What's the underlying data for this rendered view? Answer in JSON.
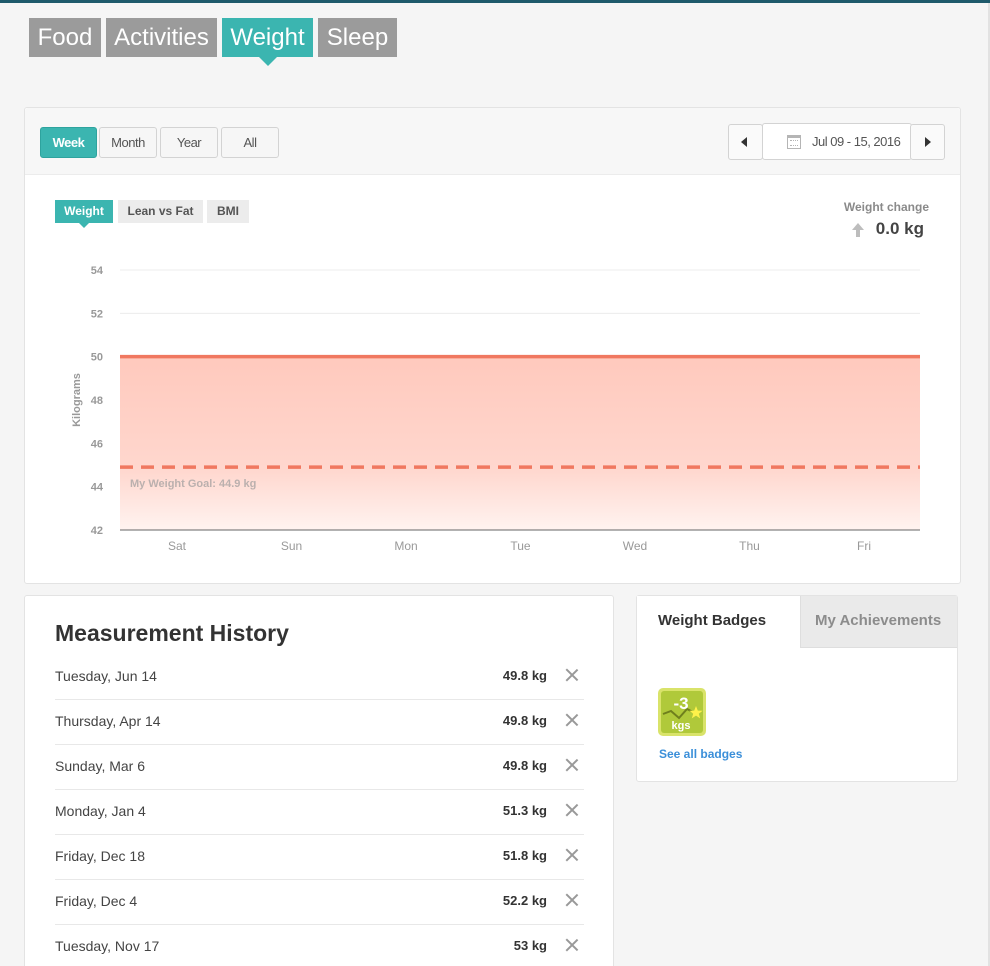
{
  "main_tabs": [
    {
      "label": "Food"
    },
    {
      "label": "Activities"
    },
    {
      "label": "Weight",
      "active": true
    },
    {
      "label": "Sleep"
    }
  ],
  "range_buttons": [
    {
      "label": "Week",
      "active": true
    },
    {
      "label": "Month"
    },
    {
      "label": "Year"
    },
    {
      "label": "All"
    }
  ],
  "date_range": "Jul 09 - 15, 2016",
  "chart_tabs": [
    {
      "label": "Weight",
      "active": true
    },
    {
      "label": "Lean vs Fat"
    },
    {
      "label": "BMI"
    }
  ],
  "weight_change": {
    "label": "Weight change",
    "value": "0.0 kg"
  },
  "colors": {
    "accent": "#3bb5b0",
    "series": "#f07860",
    "fill": "#ffcfc4",
    "link": "#3b8fd9",
    "badge": "#b0c93a"
  },
  "chart_data": {
    "type": "area",
    "ylabel": "Kilograms",
    "xlabel": "",
    "categories": [
      "Sat",
      "Sun",
      "Mon",
      "Tue",
      "Wed",
      "Thu",
      "Fri"
    ],
    "series": [
      {
        "values": [
          50,
          50,
          50,
          50,
          50,
          50,
          50
        ]
      }
    ],
    "goal": {
      "label": "My Weight Goal: 44.9 kg",
      "value": 44.9
    },
    "yticks": [
      42,
      44,
      46,
      48,
      50,
      52,
      54
    ],
    "ylim": [
      42,
      54
    ],
    "grid": true
  },
  "history": {
    "title": "Measurement History",
    "rows": [
      {
        "date": "Tuesday, Jun 14",
        "value": "49.8 kg"
      },
      {
        "date": "Thursday, Apr 14",
        "value": "49.8 kg"
      },
      {
        "date": "Sunday, Mar 6",
        "value": "49.8 kg"
      },
      {
        "date": "Monday, Jan 4",
        "value": "51.3 kg"
      },
      {
        "date": "Friday, Dec 18",
        "value": "51.8 kg"
      },
      {
        "date": "Friday, Dec 4",
        "value": "52.2 kg"
      },
      {
        "date": "Tuesday, Nov 17",
        "value": "53 kg"
      }
    ]
  },
  "badges": {
    "tabs": [
      {
        "label": "Weight Badges",
        "active": true
      },
      {
        "label": "My Achievements"
      }
    ],
    "badge": {
      "number": "-3",
      "unit": "kgs",
      "icon": "weight-badge-icon"
    },
    "see_all": "See all badges"
  }
}
